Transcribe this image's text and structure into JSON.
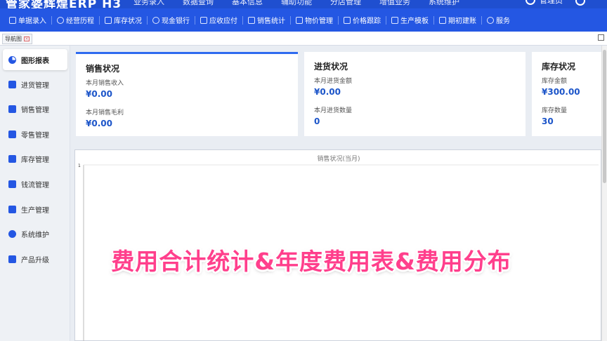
{
  "app": {
    "brand": "管家婆辉煌ERP H3",
    "top_menu": [
      "业务录入",
      "数据查询",
      "基本信息",
      "辅助功能",
      "分店管理",
      "增值业务",
      "系统维护"
    ],
    "user_label": "管理员"
  },
  "toolbar": {
    "items": [
      {
        "label": "单据录入",
        "icon": "edit-icon"
      },
      {
        "label": "经营历程",
        "icon": "check-circle-icon"
      },
      {
        "label": "库存状况",
        "icon": "calendar-icon"
      },
      {
        "label": "现金银行",
        "icon": "yen-icon"
      },
      {
        "label": "应收应付",
        "icon": "ledger-icon"
      },
      {
        "label": "销售统计",
        "icon": "chart-edit-icon"
      },
      {
        "label": "物价管理",
        "icon": "chat-icon"
      },
      {
        "label": "价格跟踪",
        "icon": "target-icon"
      },
      {
        "label": "生产模板",
        "icon": "template-icon"
      },
      {
        "label": "期初建账",
        "icon": "book-icon"
      },
      {
        "label": "服务",
        "icon": "help-icon"
      }
    ]
  },
  "tabs": {
    "nav_tab_label": "导航图"
  },
  "sidebar": {
    "items": [
      {
        "label": "图形报表",
        "icon": "pie-chart-icon",
        "active": true
      },
      {
        "label": "进货管理",
        "icon": "box-icon"
      },
      {
        "label": "销售管理",
        "icon": "bar-chart-icon"
      },
      {
        "label": "零售管理",
        "icon": "tag-icon"
      },
      {
        "label": "库存管理",
        "icon": "warehouse-icon"
      },
      {
        "label": "钱流管理",
        "icon": "money-icon"
      },
      {
        "label": "生产管理",
        "icon": "wrench-icon"
      },
      {
        "label": "系统维护",
        "icon": "gear-icon"
      },
      {
        "label": "产品升级",
        "icon": "upgrade-icon"
      }
    ]
  },
  "cards": {
    "sales": {
      "title": "销售状况",
      "label1": "本月销售收入",
      "value1": "¥0.00",
      "label2": "本月销售毛利",
      "value2": "¥0.00"
    },
    "purchase": {
      "title": "进货状况",
      "label1": "本月进货金额",
      "value1": "¥0.00",
      "label2": "本月进货数量",
      "value2": "0"
    },
    "stock": {
      "title": "库存状况",
      "label1": "库存金额",
      "value1": "¥300.00",
      "label2": "库存数量",
      "value2": "30"
    }
  },
  "chart_data": {
    "type": "bar",
    "title": "销售状况(当月)",
    "categories": [],
    "values": [],
    "y_tick_labels": [
      "1"
    ],
    "ylim": [
      0,
      1
    ]
  },
  "overlay_caption": "费用合计统计&年度费用表&费用分布",
  "colors": {
    "primary": "#2457e3",
    "value_blue": "#1c55c9",
    "caption_pink": "#ff3f8c"
  }
}
